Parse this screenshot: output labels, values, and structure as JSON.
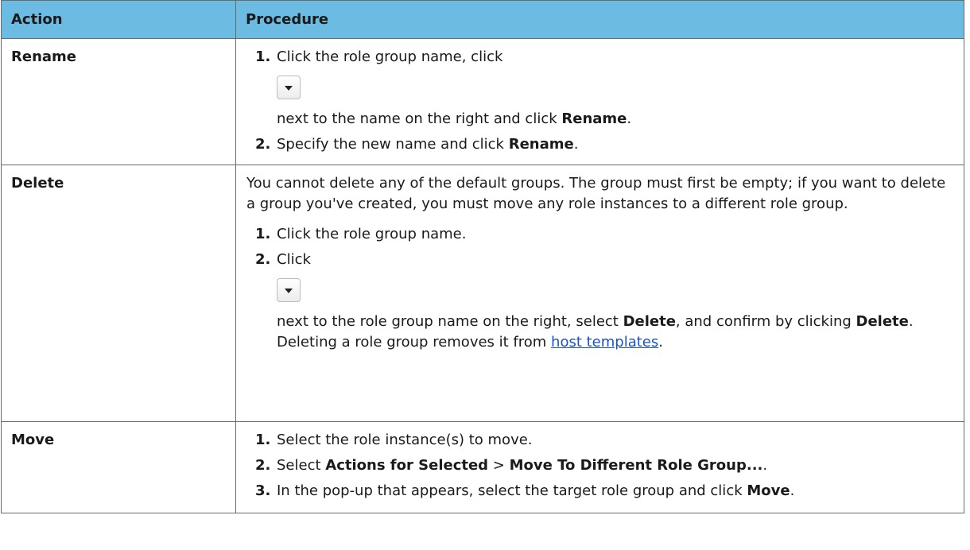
{
  "table": {
    "headers": [
      "Action",
      "Procedure"
    ],
    "rows": {
      "rename": {
        "action": "Rename",
        "steps": [
          {
            "num": "1.",
            "pre": "Click the role group name, click",
            "icon": "dropdown-caret-icon",
            "post": "next to the name on the right and click ",
            "bold": "Rename",
            "end": "."
          },
          {
            "num": "2.",
            "pre": "Specify the new name and click ",
            "bold": "Rename",
            "end": "."
          }
        ]
      },
      "delete": {
        "action": "Delete",
        "intro": "You cannot delete any of the default groups. The group must first be empty; if you want to delete a group you've created, you must move any role instances to a different role group.",
        "steps": [
          {
            "num": "1.",
            "text": "Click the role group name."
          },
          {
            "num": "2.",
            "pre": "Click",
            "icon": "dropdown-caret-icon",
            "post": "next to the role group name on the right, select ",
            "bold1": "Delete",
            "mid": ", and confirm by clicking ",
            "bold2": "Delete",
            "mid2": ". Deleting a role group removes it from ",
            "link": "host templates",
            "end": "."
          }
        ]
      },
      "move": {
        "action": "Move",
        "steps": [
          {
            "num": "1.",
            "text": "Select the role instance(s) to move."
          },
          {
            "num": "2.",
            "pre": "Select ",
            "bold1": "Actions for Selected",
            "sep": " > ",
            "bold2": "Move To Different Role Group...",
            "end": "."
          },
          {
            "num": "3.",
            "pre": "In the pop-up that appears, select the target role group and click ",
            "bold": "Move",
            "end": "."
          }
        ]
      }
    }
  },
  "colors": {
    "header_bg": "#6bbbe3",
    "border": "#6a6a6a",
    "link": "#1a52c9"
  }
}
